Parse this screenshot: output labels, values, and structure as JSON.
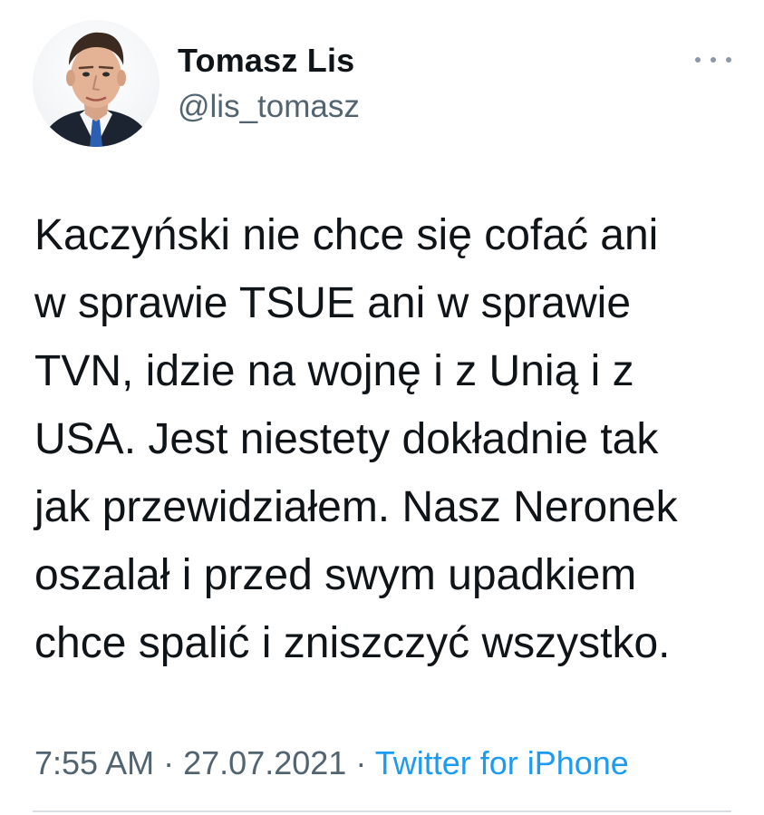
{
  "author": {
    "display_name": "Tomasz Lis",
    "handle": "@lis_tomasz",
    "avatar_icon": "profile-photo"
  },
  "tweet": {
    "lines": [
      "Kaczyński nie chce się cofać ani",
      "w sprawie TSUE ani w sprawie",
      "TVN, idzie na wojnę i z Unią i z",
      "USA. Jest niestety dokładnie tak",
      "jak przewidziałem. Nasz Neronek",
      "oszalał i przed swym upadkiem",
      "chce spalić i zniszczyć wszystko."
    ]
  },
  "meta": {
    "time": "7:55 AM",
    "separator": "·",
    "date": "27.07.2021",
    "source": "Twitter for iPhone"
  },
  "colors": {
    "text": "#0f1419",
    "secondary": "#536471",
    "link": "#1d9bf0",
    "divider": "#d9dee2"
  },
  "icons": {
    "more": "more-horizontal-icon"
  }
}
